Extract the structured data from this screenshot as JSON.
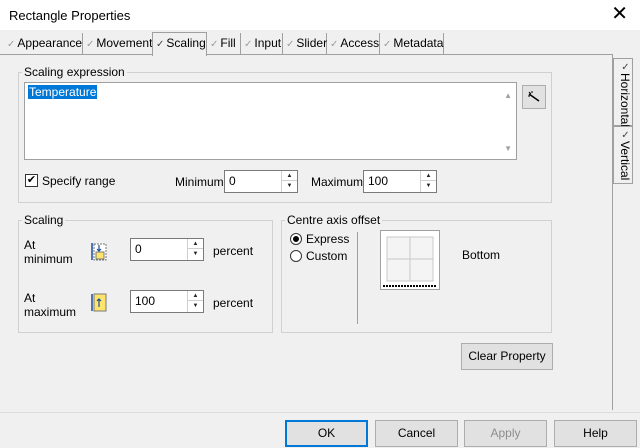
{
  "window": {
    "title": "Rectangle Properties"
  },
  "tabs": [
    {
      "label": "Appearance",
      "checked": true,
      "active": false
    },
    {
      "label": "Movement",
      "checked": true,
      "active": false
    },
    {
      "label": "Scaling",
      "checked": true,
      "active": true
    },
    {
      "label": "Fill",
      "checked": true,
      "active": false
    },
    {
      "label": "Input",
      "checked": true,
      "active": false
    },
    {
      "label": "Slider",
      "checked": true,
      "active": false
    },
    {
      "label": "Access",
      "checked": true,
      "active": false
    },
    {
      "label": "Metadata",
      "checked": true,
      "active": false
    }
  ],
  "side_tabs": [
    {
      "label": "Horizontal",
      "checked": true,
      "active": false
    },
    {
      "label": "Vertical",
      "checked": true,
      "active": true
    }
  ],
  "scaling_expression": {
    "legend": "Scaling expression",
    "value": "Temperature",
    "wizard_icon": "wand-icon"
  },
  "range": {
    "specify_range_label": "Specify range",
    "specify_range_checked": true,
    "minimum_label": "Minimum",
    "minimum_value": "0",
    "maximum_label": "Maximum",
    "maximum_value": "100"
  },
  "scaling": {
    "legend": "Scaling",
    "at_minimum_label": "At minimum",
    "at_minimum_value": "0",
    "at_maximum_label": "At maximum",
    "at_maximum_value": "100",
    "unit": "percent"
  },
  "centre_axis": {
    "legend": "Centre axis offset",
    "options": [
      "Express",
      "Custom"
    ],
    "selected": "Express",
    "anchor_label": "Bottom"
  },
  "buttons": {
    "clear_property": "Clear Property",
    "ok": "OK",
    "cancel": "Cancel",
    "apply": "Apply",
    "help": "Help"
  },
  "colors": {
    "selection": "#0078d7",
    "default_button_border": "#0078d7"
  }
}
